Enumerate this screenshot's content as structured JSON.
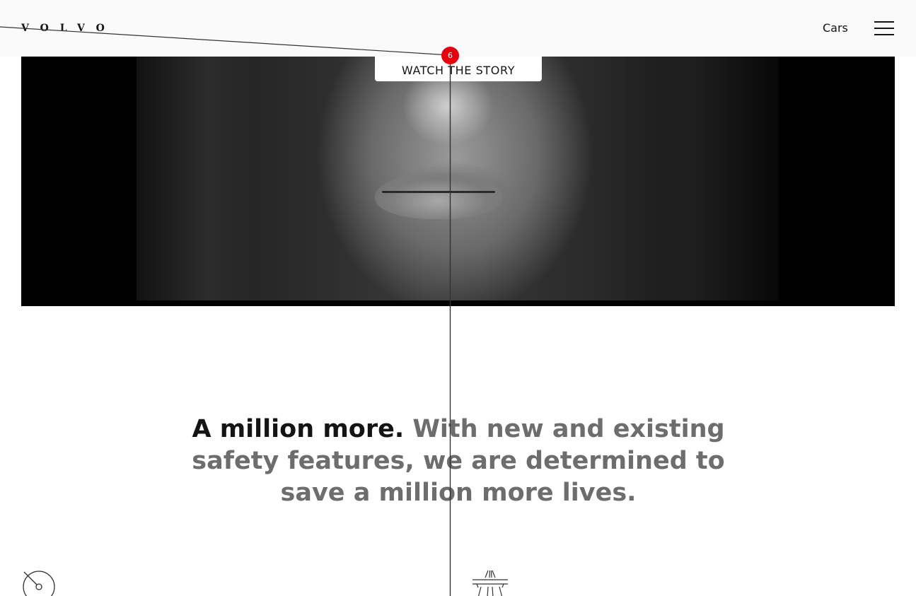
{
  "header": {
    "logo_text": "VOLVO",
    "nav_cars_label": "Cars",
    "menu_icon": "hamburger-menu-icon"
  },
  "hero": {
    "watch_button_label": "WATCH THE STORY"
  },
  "headline": {
    "lead": "A million more.",
    "body": "With new and existing safety features, we are determined to save a million more lives."
  },
  "icons": {
    "left": "speedometer-icon",
    "right": "highway-icon"
  },
  "annotation": {
    "marker_label": "6",
    "marker_color": "#e8000e"
  }
}
